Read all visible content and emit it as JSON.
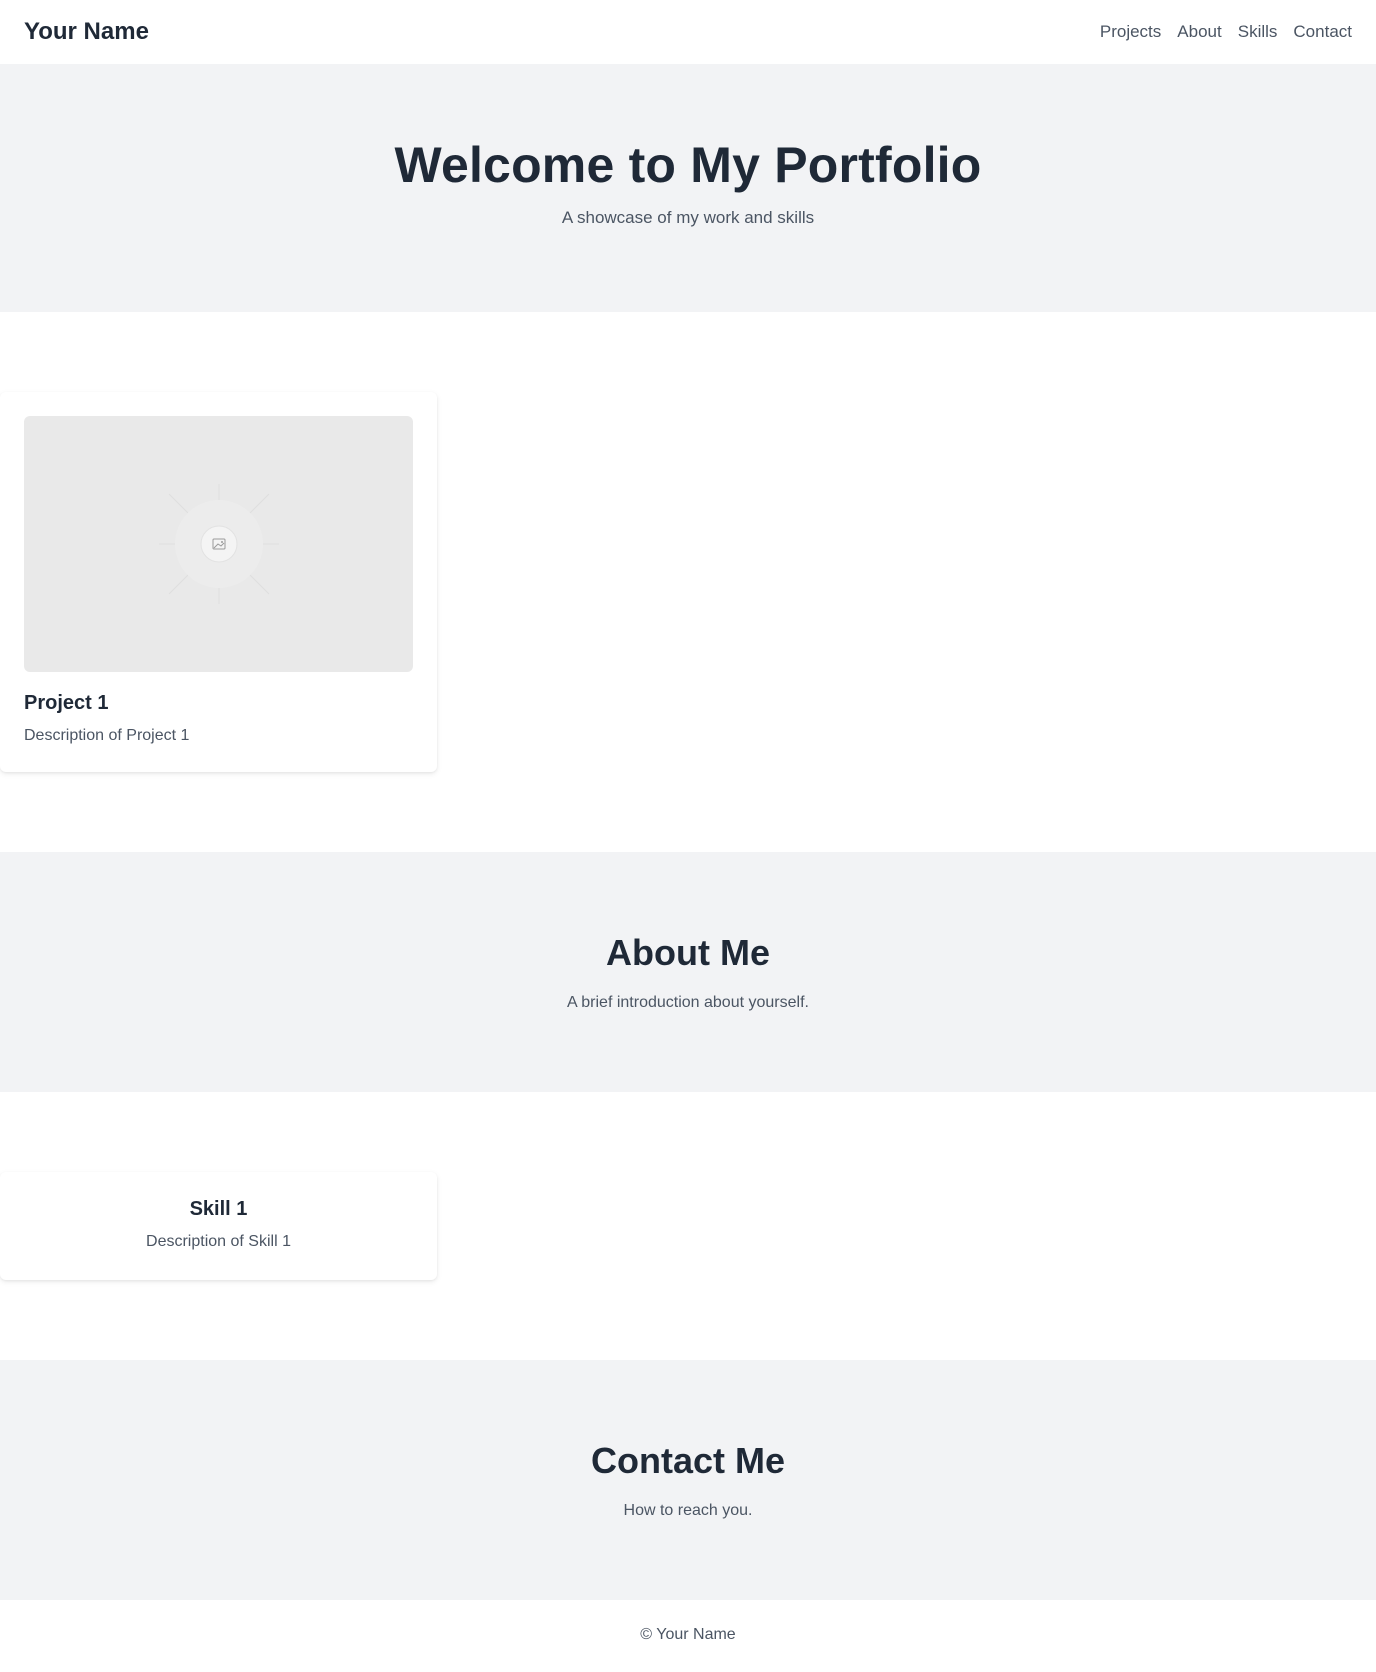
{
  "header": {
    "brand": "Your Name",
    "nav": [
      "Projects",
      "About",
      "Skills",
      "Contact"
    ]
  },
  "hero": {
    "title": "Welcome to My Portfolio",
    "subtitle": "A showcase of my work and skills"
  },
  "projects": {
    "items": [
      {
        "title": "Project 1",
        "description": "Description of Project 1",
        "image_icon": "image-placeholder-icon"
      }
    ]
  },
  "about": {
    "title": "About Me",
    "text": "A brief introduction about yourself."
  },
  "skills": {
    "items": [
      {
        "title": "Skill 1",
        "description": "Description of Skill 1"
      }
    ]
  },
  "contact": {
    "title": "Contact Me",
    "text": "How to reach you."
  },
  "footer": {
    "text": "© Your Name"
  },
  "colors": {
    "text_primary": "#1f2937",
    "text_secondary": "#4b5563",
    "section_alt_bg": "#f2f3f5",
    "image_placeholder_bg": "#e9e9e9"
  }
}
